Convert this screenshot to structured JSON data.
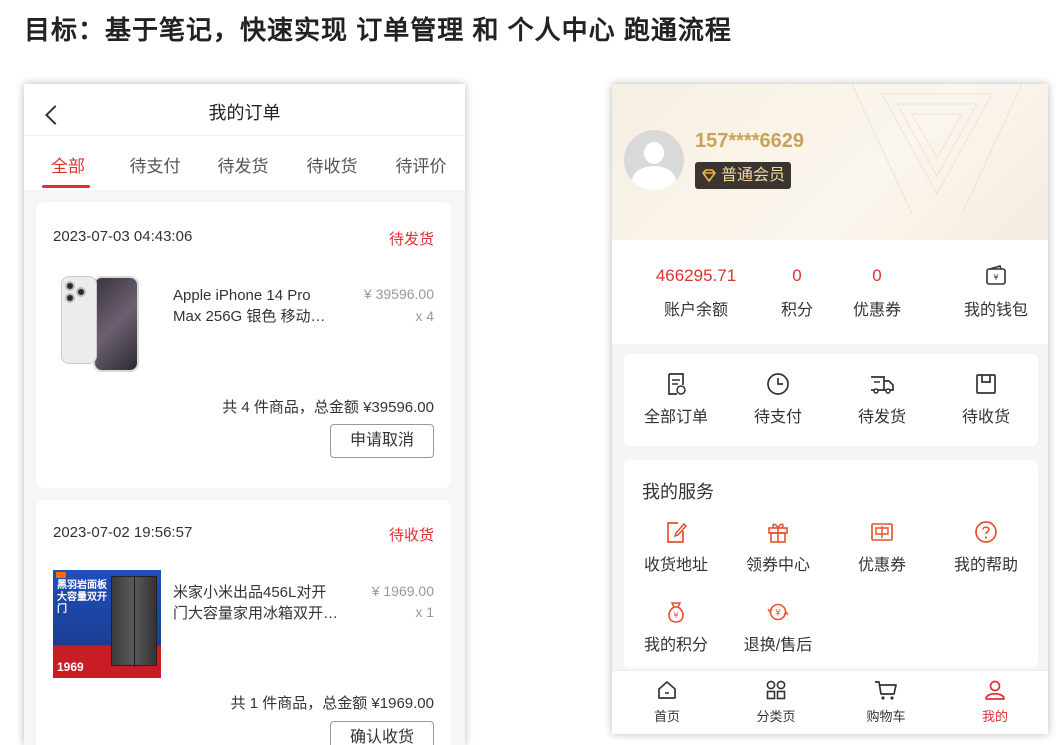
{
  "heading": "目标：基于笔记，快速实现 订单管理 和 个人中心 跑通流程",
  "orders_screen": {
    "title": "我的订单",
    "tabs": [
      {
        "label": "全部",
        "active": true
      },
      {
        "label": "待支付",
        "active": false
      },
      {
        "label": "待发货",
        "active": false
      },
      {
        "label": "待收货",
        "active": false
      },
      {
        "label": "待评价",
        "active": false
      }
    ],
    "orders": [
      {
        "date": "2023-07-03 04:43:06",
        "status": "待发货",
        "product_line1": "Apple iPhone 14 Pro",
        "product_line2": "Max 256G 银色 移动…",
        "price": "¥ 39596.00",
        "qty": "x 4",
        "summary": "共 4 件商品，总金额 ¥39596.00",
        "action": "申请取消"
      },
      {
        "date": "2023-07-02 19:56:57",
        "status": "待收货",
        "product_line1": "米家小米出品456L对开",
        "product_line2": "门大容量家用冰箱双开…",
        "price": "¥ 1969.00",
        "qty": "x 1",
        "summary": "共 1 件商品，总金额 ¥1969.00",
        "action": "确认收货",
        "ad_text_top": "黑羽岩面板 大容量双开门",
        "ad_price": "1969"
      }
    ]
  },
  "profile_screen": {
    "phone": "157****6629",
    "member_level": "普通会员",
    "stats": [
      {
        "value": "466295.71",
        "label": "账户余额"
      },
      {
        "value": "0",
        "label": "积分"
      },
      {
        "value": "0",
        "label": "优惠券"
      }
    ],
    "wallet_label": "我的钱包",
    "order_shortcuts": [
      {
        "label": "全部订单",
        "icon": "order-list-icon"
      },
      {
        "label": "待支付",
        "icon": "clock-icon"
      },
      {
        "label": "待发货",
        "icon": "truck-icon"
      },
      {
        "label": "待收货",
        "icon": "box-icon"
      }
    ],
    "services_title": "我的服务",
    "services": [
      {
        "label": "收货地址",
        "icon": "edit-note-icon"
      },
      {
        "label": "领券中心",
        "icon": "gift-icon"
      },
      {
        "label": "优惠券",
        "icon": "coupon-icon"
      },
      {
        "label": "我的帮助",
        "icon": "help-icon"
      },
      {
        "label": "我的积分",
        "icon": "money-bag-icon"
      },
      {
        "label": "退换/售后",
        "icon": "refund-icon"
      }
    ],
    "tabbar": [
      {
        "label": "首页",
        "icon": "home-icon",
        "active": false
      },
      {
        "label": "分类页",
        "icon": "category-icon",
        "active": false
      },
      {
        "label": "购物车",
        "icon": "cart-icon",
        "active": false
      },
      {
        "label": "我的",
        "icon": "user-icon",
        "active": true
      }
    ],
    "colors": {
      "accent": "#e03131",
      "gold": "#c8a35a",
      "icon_red": "#e8502e"
    }
  }
}
